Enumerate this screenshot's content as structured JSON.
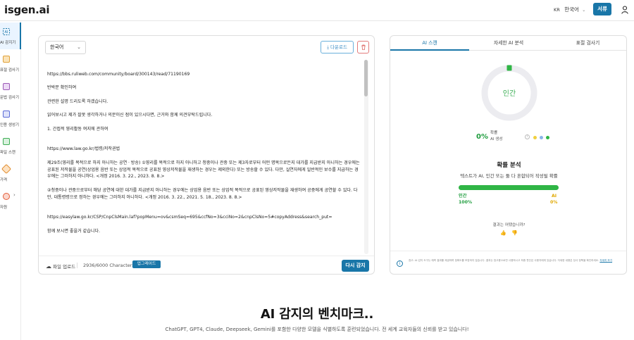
{
  "header": {
    "logo": "isgen.ai",
    "lang_code": "KR",
    "lang_label": "한국어",
    "signin_label": "서류"
  },
  "sidebar": {
    "items": [
      {
        "label": "AI 감지기",
        "icon": "ai-detector-icon",
        "color": "#1976a8"
      },
      {
        "label": "표절 검사기",
        "icon": "plagiarism-icon",
        "color": "#e0a23a"
      },
      {
        "label": "문법 검사기",
        "icon": "grammar-icon",
        "color": "#9b59b6"
      },
      {
        "label": "인용 생성기",
        "icon": "citation-icon",
        "color": "#5b6bd6"
      },
      {
        "label": "파일 스캔",
        "icon": "file-scan-icon",
        "color": "#3fae55"
      },
      {
        "label": "가격",
        "icon": "pricing-tag-icon",
        "color": "#e08a2a"
      },
      {
        "label": "자원",
        "icon": "resources-icon",
        "color": "#e35d3a"
      }
    ]
  },
  "editor": {
    "language": "한국어",
    "download_label": "다운로드",
    "paragraphs": [
      "https://bbs.ruliweb.com/community/board/300143/read/71190169",
      "반박문 확인하여",
      "관련한 설명 드리도록 하겠습니다.",
      "읽어보시고 제가 잘못 생각하거나 의문이신 점이 있으시다면, 근거와 함께 의견부탁드립니다.",
      "1. 간접적 영리활동 여지에 관하여",
      "https://www.law.go.kr/법령/저작권법",
      "제29조(영리를 목적으로 하지 아니하는 공연ㆍ방송) ①영리를 목적으로 하지 아니하고 청중이나 관중 또는 제3자로부터 어떤 명목으로든지 대가를 지급받지 아니하는 경우에는 공표된 저작물을 공연(상업용 음반 또는 상업적 목적으로 공표된 영상저작물을 재생하는 경우는 제외한다) 또는 방송할 수 있다. 다만, 실연자에게 일반적인 보수를 지급하는 경우에는 그러하지 아니하다. <개정 2016. 3. 22., 2023. 8. 8.>",
      "②청중이나 관중으로부터 해당 공연에 대한 대가를 지급받지 아니하는 경우에는 상업용 음반 또는 상업적 목적으로 공표된 영상저작물을 재생하여 공중에게 공연할 수 있다. 다만, 대통령령으로 정하는 경우에는 그러하지 아니하다. <개정 2016. 3. 22., 2021. 5. 18., 2023. 8. 8.>",
      "https://easylaw.go.kr/CSP/CnpClsMain.laf?popMenu=ov&csmSeq=695&ccfNo=3&cciNo=2&cnpClsNo=5#copyAddress&search_put=",
      "함께 보시면 좋을거 같습니다."
    ],
    "upload_label": "파일 업로드",
    "char_count": "2936/6000 Characters",
    "upgrade_label": "업그레이드",
    "recheck_label": "다시 감지"
  },
  "panel": {
    "tabs": [
      "AI 스캔",
      "자세한 AI 분석",
      "표절 검사기"
    ],
    "active_tab": 0,
    "donut_label": "인간",
    "ai_percent": "0%",
    "ai_percent_value": 0,
    "percent_label_line1": "확률",
    "percent_label_line2": "AI 생성",
    "legend_colors": [
      "#f0d040",
      "#8ab4e8",
      "#2fb545"
    ],
    "prob_title": "확률 분석",
    "prob_subtitle": "텍스트가 AI, 인간 또는 둘 다 혼합되어 작성될 확률",
    "human_label": "인간",
    "human_pct": "100%",
    "human_value": 100,
    "ai_label": "AI",
    "ai_pct": "0%",
    "feedback_label": "결과는 어땠습니까?",
    "disclaimer": "참고: AI 감지 도구는 예측 결과를 제공하며 정확도를 보장하지 않습니다. 결과는 참고용으로만 사용하시고 최종 판단은 사용자에게 있습니다. 자세한 내용은 당사 정책을 확인하세요.",
    "disclaimer_link": "자세히 보기"
  },
  "colors": {
    "accent": "#1976a8",
    "human_green": "#2fb545",
    "ai_yellow": "#e0a800"
  },
  "benchmark": {
    "title": "AI 감지의 벤치마크..",
    "subtitle": "ChatGPT, GPT4, Claude, Deepseek, Gemini를 포함한 다양한 모델을 식별하도록 훈련되었습니다. 전 세계 교육자들의 신뢰를 받고 있습니다!"
  }
}
